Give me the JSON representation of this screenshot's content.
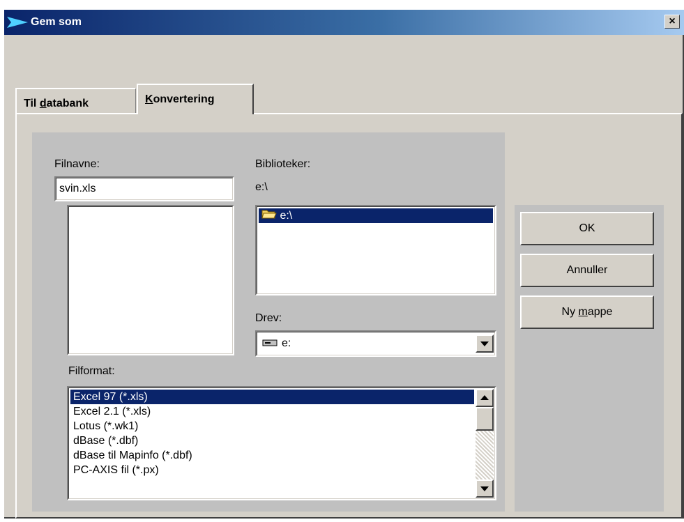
{
  "window": {
    "title": "Gem som",
    "close_glyph": "×"
  },
  "tabs": [
    {
      "prefix": "Til ",
      "accel": "d",
      "suffix": "atabank",
      "active": false
    },
    {
      "prefix": "",
      "accel": "K",
      "suffix": "onvertering",
      "active": true
    }
  ],
  "filnavne": {
    "label": "Filnavne:",
    "value": "svin.xls",
    "files": []
  },
  "biblioteker": {
    "label": "Biblioteker:",
    "current_path": "e:\\",
    "items": [
      {
        "label": "e:\\",
        "icon": "open-folder-icon",
        "selected": true
      }
    ]
  },
  "drev": {
    "label": "Drev:",
    "value": "e:",
    "icon": "drive-icon"
  },
  "filformat": {
    "label": "Filformat:",
    "items": [
      {
        "label": "Excel 97 (*.xls)",
        "selected": true
      },
      {
        "label": "Excel 2.1 (*.xls)"
      },
      {
        "label": "Lotus (*.wk1)"
      },
      {
        "label": "dBase (*.dbf)"
      },
      {
        "label": "dBase til Mapinfo (*.dbf)"
      },
      {
        "label": "PC-AXIS fil (*.px)"
      }
    ]
  },
  "buttons": {
    "ok": "OK",
    "annuller": "Annuller",
    "ny_mappe": {
      "prefix": "Ny ",
      "accel": "m",
      "suffix": "appe"
    }
  },
  "colors": {
    "selection": "#0a246a",
    "face": "#d4d0c8",
    "title_start": "#0a246a",
    "title_end": "#a6caf0"
  }
}
